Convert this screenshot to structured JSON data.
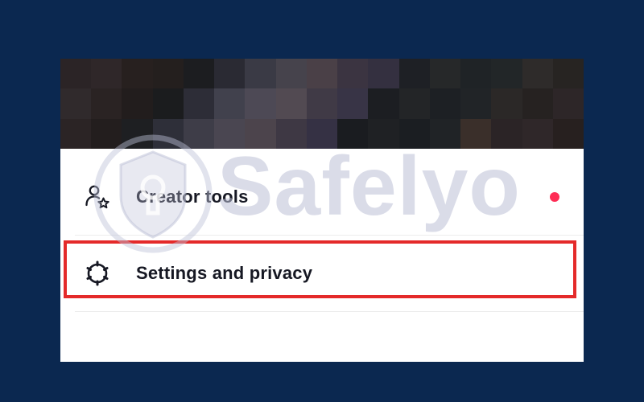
{
  "menu": {
    "items": [
      {
        "label": "Creator tools",
        "icon": "person-star-icon",
        "has_notification_dot": true
      },
      {
        "label": "Settings and privacy",
        "icon": "gear-icon",
        "highlighted": true
      }
    ]
  },
  "watermark": {
    "text": "Safelyo",
    "icon": "shield-lock-icon"
  },
  "colors": {
    "page_background": "#0b2850",
    "sheet_background": "#ffffff",
    "label_text": "#161823",
    "notification_dot": "#fe2c55",
    "highlight_border": "#e42a2a",
    "watermark": "#bcc0d6"
  }
}
